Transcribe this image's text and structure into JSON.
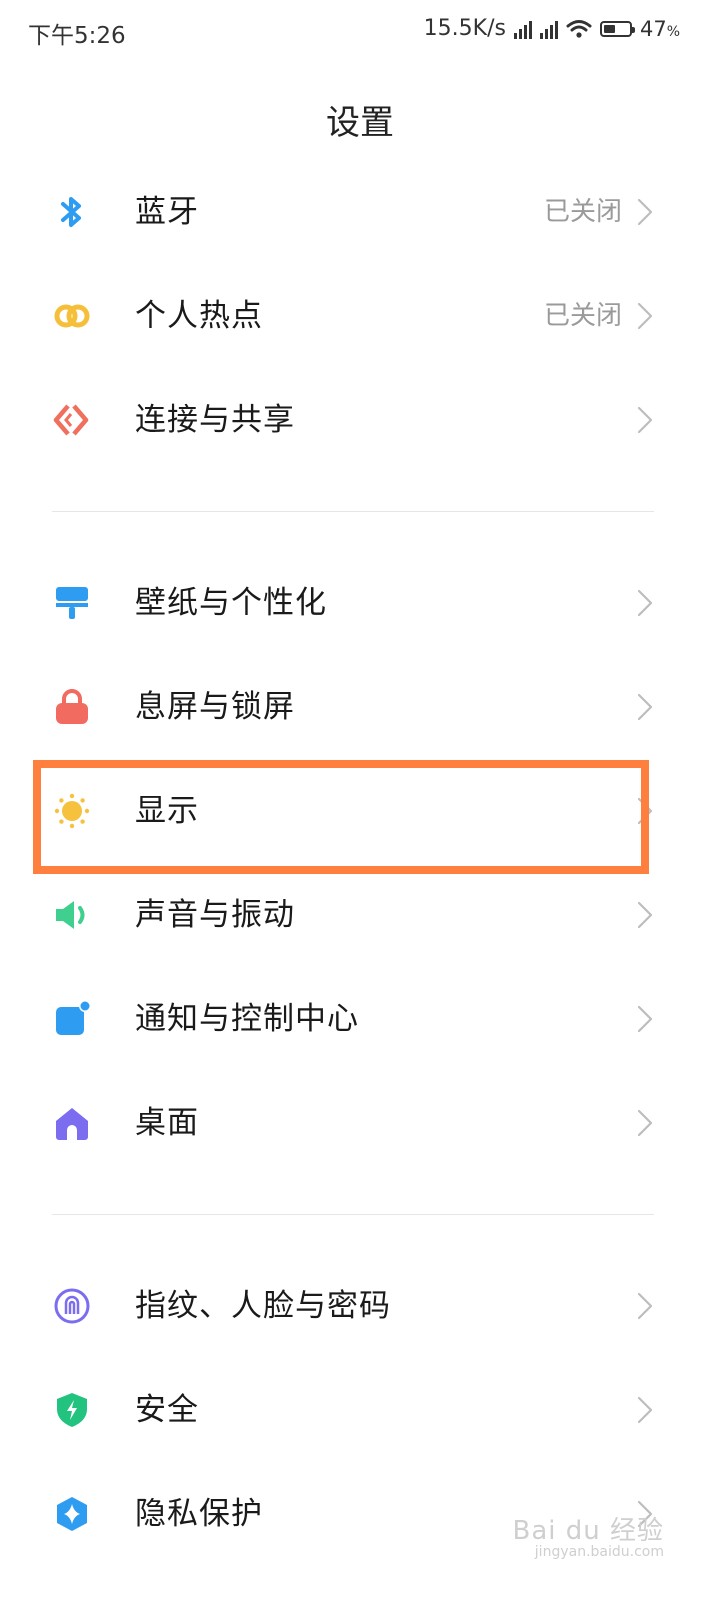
{
  "status_bar": {
    "time": "下午5:26",
    "speed": "15.5K/s",
    "battery": "47",
    "battery_unit": "%",
    "battery_level": 0.47
  },
  "header": {
    "title": "设置"
  },
  "groups": [
    [
      {
        "label": "蓝牙",
        "value": "已关闭",
        "icon": "bluetooth-icon",
        "color": "#2e9cf1"
      },
      {
        "label": "个人热点",
        "value": "已关闭",
        "icon": "hotspot-icon",
        "color": "#f5bf3a"
      },
      {
        "label": "连接与共享",
        "value": "",
        "icon": "connection-icon",
        "color": "#f0705d"
      }
    ],
    [
      {
        "label": "壁纸与个性化",
        "value": "",
        "icon": "wallpaper-icon",
        "color": "#2e9cf1"
      },
      {
        "label": "息屏与锁屏",
        "value": "",
        "icon": "lock-icon",
        "color": "#f26b60"
      },
      {
        "label": "显示",
        "value": "",
        "icon": "brightness-icon",
        "color": "#f6c23d"
      },
      {
        "label": "声音与振动",
        "value": "",
        "icon": "speaker-icon",
        "color": "#3fcf8e"
      },
      {
        "label": "通知与控制中心",
        "value": "",
        "icon": "notification-icon",
        "color": "#2e9cf1"
      },
      {
        "label": "桌面",
        "value": "",
        "icon": "home-icon",
        "color": "#7b6cf0"
      }
    ],
    [
      {
        "label": "指纹、人脸与密码",
        "value": "",
        "icon": "fingerprint-icon",
        "color": "#7b6cf0"
      },
      {
        "label": "安全",
        "value": "",
        "icon": "shield-icon",
        "color": "#21c37e"
      },
      {
        "label": "隐私保护",
        "value": "",
        "icon": "privacy-icon",
        "color": "#2e9cf1"
      }
    ]
  ],
  "highlight_color": "#ff7f3f",
  "watermark": {
    "text": "Bai du 经验",
    "sub": "jingyan.baidu.com"
  }
}
